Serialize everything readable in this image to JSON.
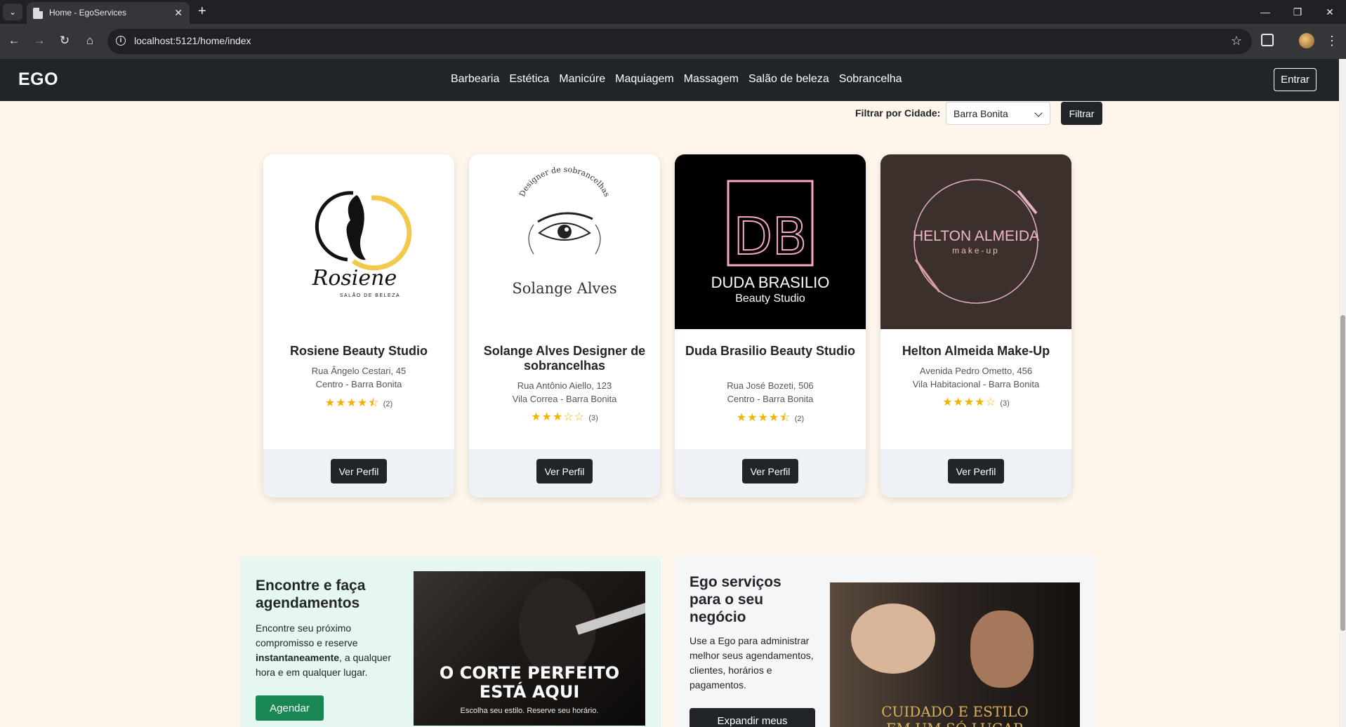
{
  "browser": {
    "tab_title": "Home - EgoServices",
    "url": "localhost:5121/home/index"
  },
  "site": {
    "brand": "EGO",
    "nav": [
      "Barbearia",
      "Estética",
      "Manicúre",
      "Maquiagem",
      "Massagem",
      "Salão de beleza",
      "Sobrancelha"
    ],
    "login_label": "Entrar"
  },
  "filter": {
    "label": "Filtrar por Cidade:",
    "selected_city": "Barra Bonita",
    "button_label": "Filtrar"
  },
  "cards": [
    {
      "name": "Rosiene Beauty Studio",
      "address1": "Rua Ângelo Cestari, 45",
      "address2": "Centro - Barra Bonita",
      "stars": "★★★★⯪",
      "reviews": "(2)",
      "rating_value": 4.5,
      "button": "Ver Perfil",
      "logo": {
        "script": "Rosiene",
        "tag": "SALÃO DE BELEZA"
      }
    },
    {
      "name": "Solange Alves Designer de sobrancelhas",
      "address1": "Rua Antônio Aiello, 123",
      "address2": "Vila Correa - Barra Bonita",
      "stars": "★★★☆☆",
      "reviews": "(3)",
      "rating_value": 3,
      "button": "Ver Perfil",
      "logo": {
        "arc": "Designer de sobrancelhas",
        "script": "Solange Alves"
      }
    },
    {
      "name": "Duda Brasilio Beauty Studio",
      "address1": "Rua José Bozeti, 506",
      "address2": "Centro - Barra Bonita",
      "stars": "★★★★⯪",
      "reviews": "(2)",
      "rating_value": 4.5,
      "button": "Ver Perfil",
      "logo": {
        "mono": "DB",
        "title": "DUDA BRASILIO",
        "sub": "Beauty Studio"
      }
    },
    {
      "name": "Helton Almeida Make-Up",
      "address1": "Avenida Pedro Ometto, 456",
      "address2": "Vila Habitacional - Barra Bonita",
      "stars": "★★★★☆",
      "reviews": "(3)",
      "rating_value": 4,
      "button": "Ver Perfil",
      "logo": {
        "title": "HELTON ALMEIDA",
        "sub": "make-up"
      }
    }
  ],
  "promo_left": {
    "title": "Encontre e faça agendamentos",
    "text_before": "Encontre seu próximo compromisso e reserve ",
    "text_bold": "instantaneamente",
    "text_after": ", a qualquer hora e em qualquer lugar.",
    "button": "Agendar",
    "image_headline_1": "O CORTE PERFEITO",
    "image_headline_2": "ESTÁ AQUI",
    "image_sub": "Escolha seu estilo. Reserve seu horário."
  },
  "promo_right": {
    "title": "Ego serviços para o seu negócio",
    "text": "Use a Ego para administrar melhor seus agendamentos, clientes, horários e pagamentos.",
    "button": "Expandir meus",
    "image_headline_1": "CUIDADO E ESTILO",
    "image_headline_2": "EM UM SÓ LUGAR"
  },
  "colors": {
    "page_bg": "#fef6ea",
    "navbar": "#212529",
    "star": "#f5b301",
    "agendar": "#198754",
    "promo_left_bg": "#e6f7f1"
  }
}
